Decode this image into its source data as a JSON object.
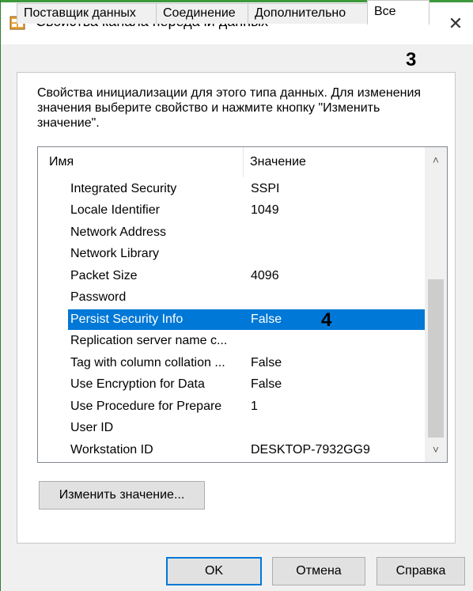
{
  "window": {
    "title": "Свойства канала передачи данных",
    "close_glyph": "✕"
  },
  "tabs": [
    {
      "label": "Поставщик данных"
    },
    {
      "label": "Соединение"
    },
    {
      "label": "Дополнительно"
    },
    {
      "label": "Все"
    }
  ],
  "annotations": {
    "tab_marker": "3",
    "row_marker": "4"
  },
  "description": "Свойства инициализации для этого типа данных. Для изменения значения выберите свойство и нажмите кнопку \"Изменить значение\".",
  "properties": {
    "headers": {
      "name": "Имя",
      "value": "Значение"
    },
    "rows": [
      {
        "name": "Integrated Security",
        "value": "SSPI"
      },
      {
        "name": "Locale Identifier",
        "value": "1049"
      },
      {
        "name": "Network Address",
        "value": ""
      },
      {
        "name": "Network Library",
        "value": ""
      },
      {
        "name": "Packet Size",
        "value": "4096"
      },
      {
        "name": "Password",
        "value": ""
      },
      {
        "name": "Persist Security Info",
        "value": "False"
      },
      {
        "name": "Replication server name c...",
        "value": ""
      },
      {
        "name": "Tag with column collation ...",
        "value": "False"
      },
      {
        "name": "Use Encryption for Data",
        "value": "False"
      },
      {
        "name": "Use Procedure for Prepare",
        "value": "1"
      },
      {
        "name": "User ID",
        "value": ""
      },
      {
        "name": "Workstation ID",
        "value": "DESKTOP-7932GG9"
      }
    ],
    "selected_index": 6
  },
  "buttons": {
    "edit_value": "Изменить значение...",
    "ok": "OK",
    "cancel": "Отмена",
    "help": "Справка"
  },
  "colors": {
    "selection": "#0078d7",
    "titlebar_accent": "#3c9a3c"
  }
}
